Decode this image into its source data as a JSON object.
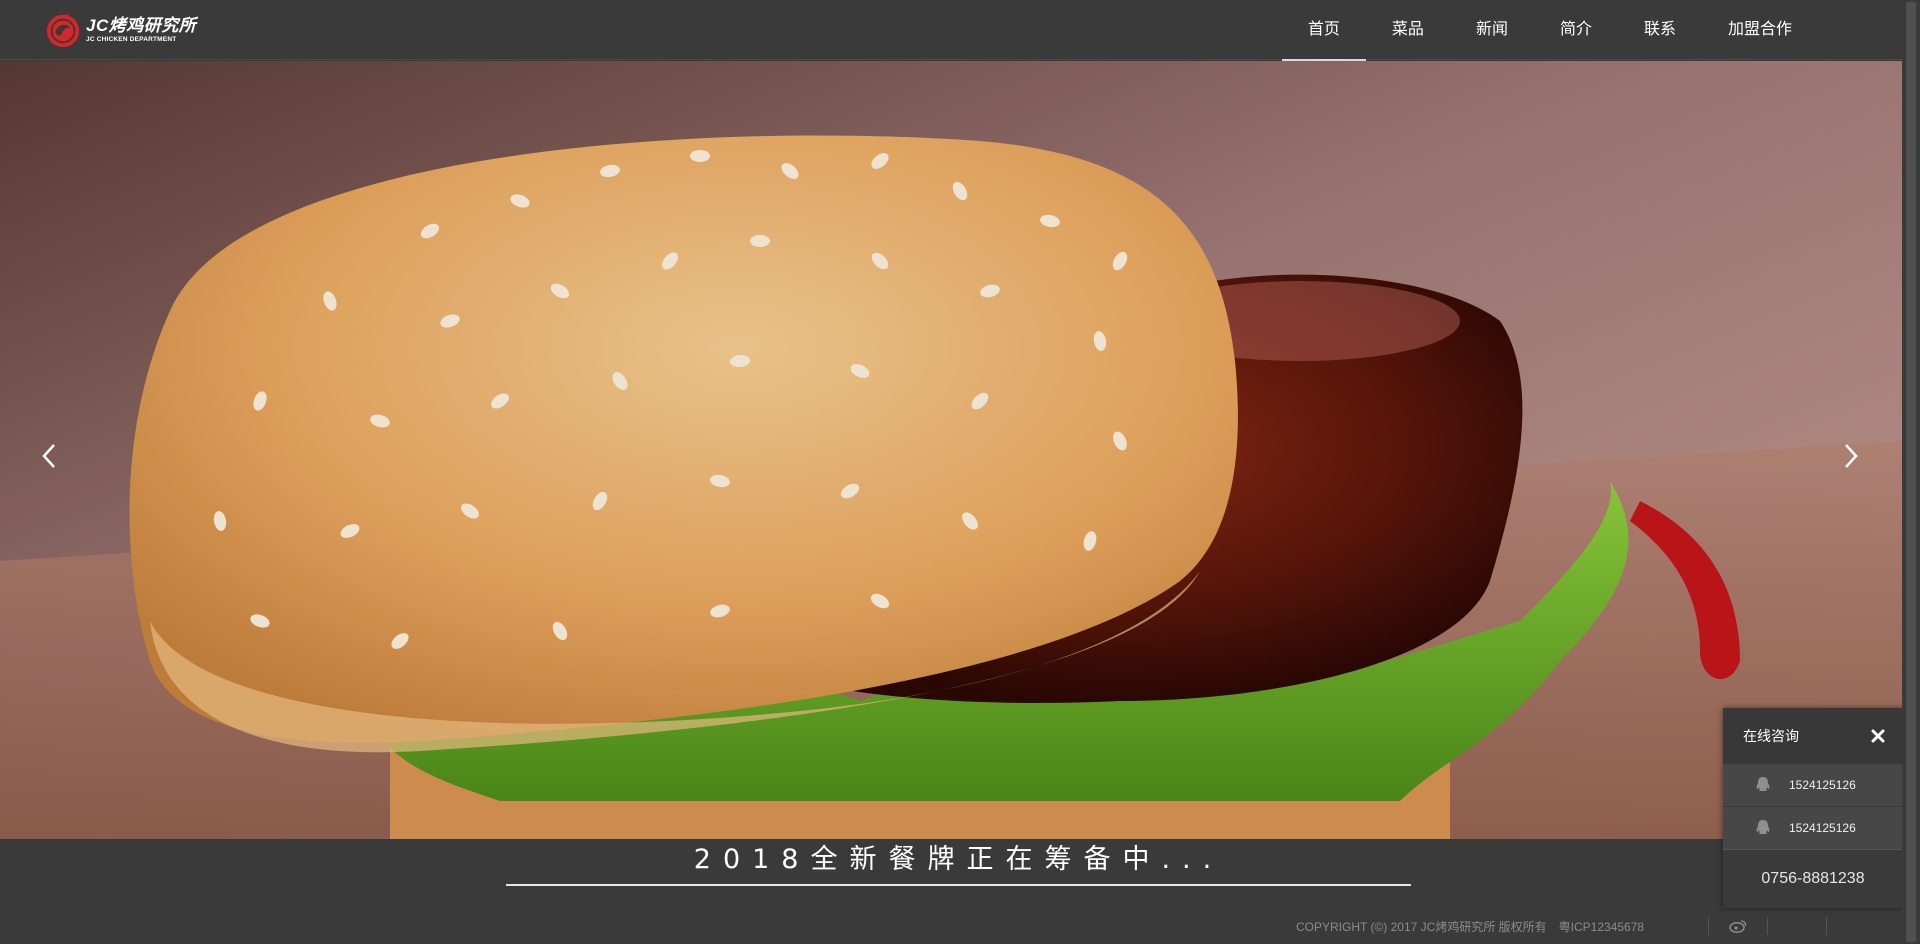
{
  "header": {
    "logo_title": "JC烤鸡研究所",
    "logo_subtitle": "JC CHICKEN DEPARTMENT",
    "nav": [
      {
        "label": "首页",
        "active": true
      },
      {
        "label": "菜品",
        "active": false
      },
      {
        "label": "新闻",
        "active": false
      },
      {
        "label": "简介",
        "active": false
      },
      {
        "label": "联系",
        "active": false
      },
      {
        "label": "加盟合作",
        "active": false
      }
    ]
  },
  "slider": {
    "icons": {
      "prev": "chevron-left-icon",
      "next": "chevron-right-icon"
    }
  },
  "tagline": "2018全新餐牌正在筹备中...",
  "footer": {
    "copyright": "COPYRIGHT (©) 2017 JC烤鸡研究所 版权所有",
    "icp": "粤ICP12345678",
    "icons": [
      "weibo-icon",
      "blank-icon"
    ]
  },
  "consult": {
    "title": "在线咨询",
    "qq_numbers": [
      "1524125126",
      "1524125126"
    ],
    "phone": "0756-8881238"
  },
  "colors": {
    "background": "#3a3a3a",
    "brand_red": "#d7262a"
  }
}
